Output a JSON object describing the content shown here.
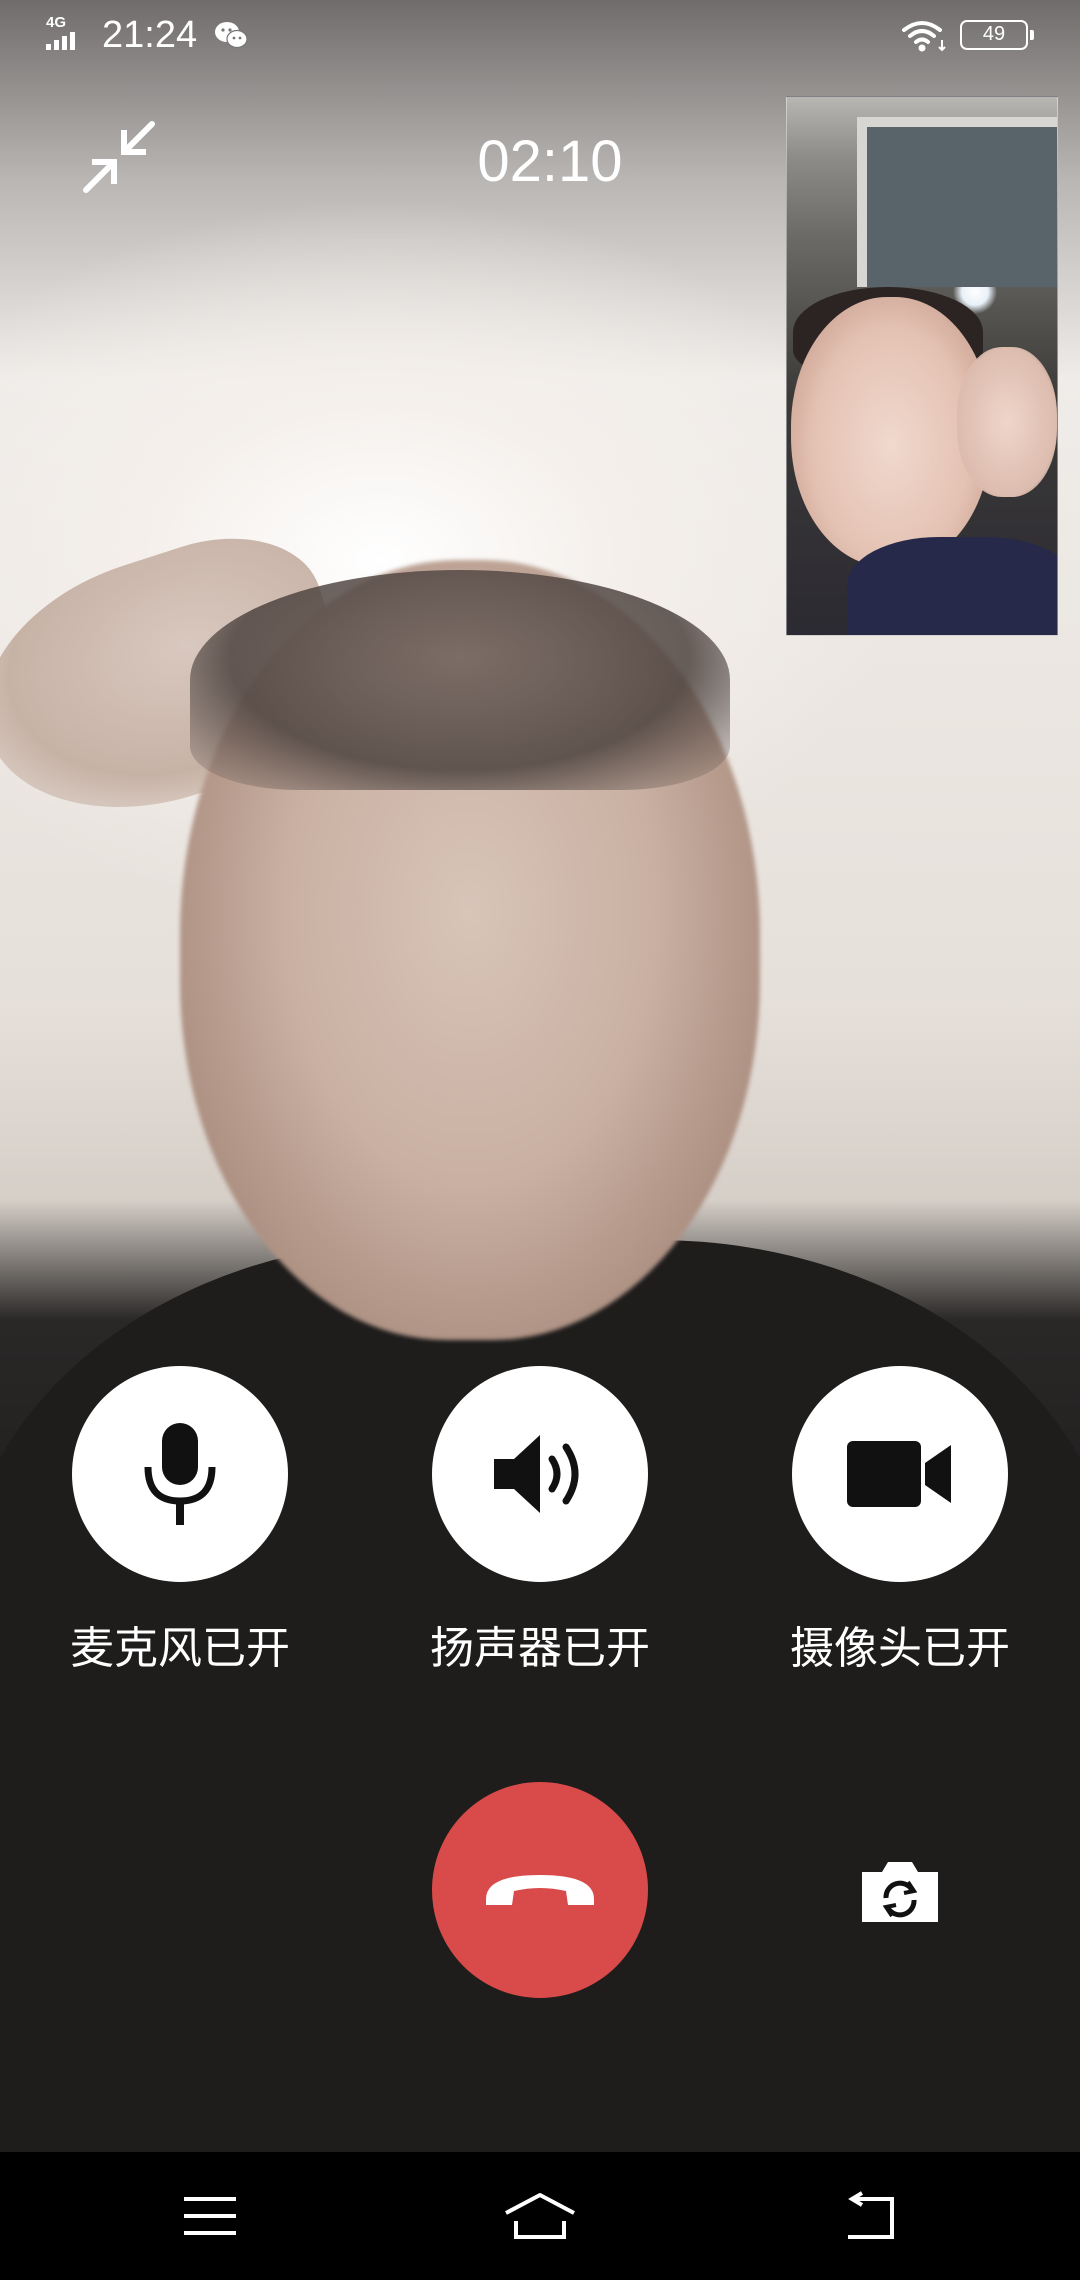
{
  "status_bar": {
    "network": "4G",
    "time": "21:24",
    "battery": "49",
    "notification_icon": "wechat-icon",
    "wifi_icon": "wifi-icon"
  },
  "call": {
    "timer": "02:10",
    "minimize_icon": "minimize-arrows-icon"
  },
  "controls": {
    "mic_label": "麦克风已开",
    "speaker_label": "扬声器已开",
    "camera_label": "摄像头已开",
    "hangup_color": "#d94a4a"
  },
  "nav": {
    "menu_icon": "menu-icon",
    "home_icon": "home-icon",
    "back_icon": "back-icon"
  }
}
